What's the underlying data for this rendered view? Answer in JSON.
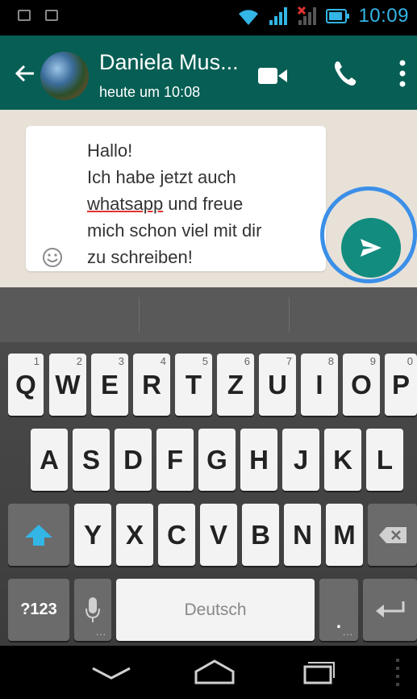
{
  "status_bar": {
    "time": "10:09",
    "accent": "#33b5e5"
  },
  "header": {
    "contact_name": "Daniela Mus...",
    "last_seen": "heute um 10:08",
    "bg_color": "#075e54"
  },
  "message": {
    "lines": [
      "Hallo!",
      "Ich habe jetzt auch",
      "whatsapp",
      " und freue",
      "mich schon viel mit dir",
      "zu schreiben!"
    ]
  },
  "send_button": {
    "icon": "send-icon",
    "color": "#128c7e",
    "highlight_color": "#3b8fe8"
  },
  "keyboard": {
    "row1": [
      {
        "label": "Q",
        "num": "1"
      },
      {
        "label": "W",
        "num": "2"
      },
      {
        "label": "E",
        "num": "3"
      },
      {
        "label": "R",
        "num": "4"
      },
      {
        "label": "T",
        "num": "5"
      },
      {
        "label": "Z",
        "num": "6"
      },
      {
        "label": "U",
        "num": "7"
      },
      {
        "label": "I",
        "num": "8"
      },
      {
        "label": "O",
        "num": "9"
      },
      {
        "label": "P",
        "num": "0"
      }
    ],
    "row2": [
      "A",
      "S",
      "D",
      "F",
      "G",
      "H",
      "J",
      "K",
      "L"
    ],
    "row3": [
      "Y",
      "X",
      "C",
      "V",
      "B",
      "N",
      "M"
    ],
    "symbols_label": "?123",
    "space_label": "Deutsch",
    "period_label": ".",
    "dots": "..."
  }
}
